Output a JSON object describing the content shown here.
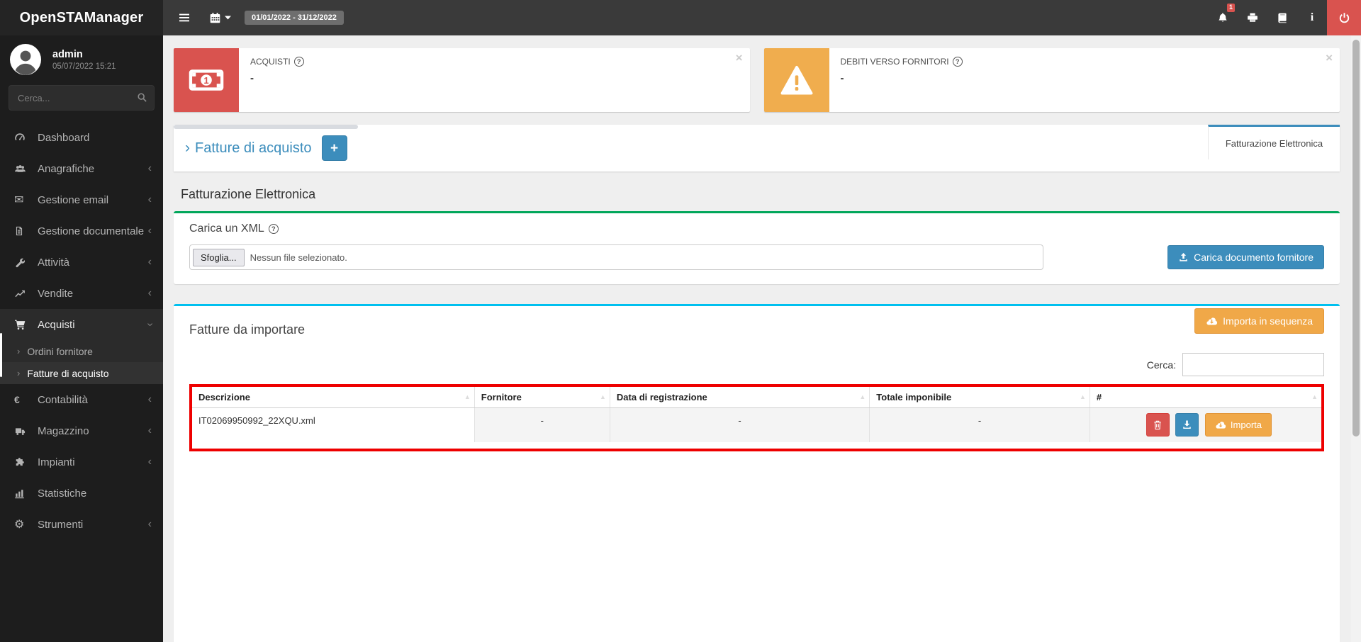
{
  "app": {
    "title": "OpenSTAManager"
  },
  "navbar": {
    "date_range": "01/01/2022 - 31/12/2022",
    "notification_count": "1"
  },
  "sidebar": {
    "user": {
      "name": "admin",
      "datetime": "05/07/2022 15:21"
    },
    "search_placeholder": "Cerca...",
    "items": [
      {
        "label": "Dashboard"
      },
      {
        "label": "Anagrafiche"
      },
      {
        "label": "Gestione email"
      },
      {
        "label": "Gestione documentale"
      },
      {
        "label": "Attività"
      },
      {
        "label": "Vendite"
      },
      {
        "label": "Acquisti"
      },
      {
        "label": "Contabilità"
      },
      {
        "label": "Magazzino"
      },
      {
        "label": "Impianti"
      },
      {
        "label": "Statistiche"
      },
      {
        "label": "Strumenti"
      }
    ],
    "acquisti_submenu": [
      {
        "label": "Ordini fornitore"
      },
      {
        "label": "Fatture di acquisto"
      }
    ]
  },
  "infoboxes": [
    {
      "label": "ACQUISTI",
      "value": "-"
    },
    {
      "label": "DEBITI VERSO FORNITORI",
      "value": "-"
    }
  ],
  "header": {
    "title": "Fatture di acquisto",
    "add_button": "+",
    "tab": "Fatturazione Elettronica"
  },
  "section": {
    "heading": "Fatturazione Elettronica"
  },
  "upload_panel": {
    "title": "Carica un XML",
    "browse_button": "Sfoglia...",
    "file_status": "Nessun file selezionato.",
    "upload_button": "Carica documento fornitore"
  },
  "import_panel": {
    "title": "Fatture da importare",
    "sequence_button": "Importa in sequenza",
    "search_label": "Cerca:",
    "search_value": "",
    "table": {
      "columns": [
        "Descrizione",
        "Fornitore",
        "Data di registrazione",
        "Totale imponibile",
        "#"
      ],
      "rows": [
        {
          "descrizione": "IT02069950992_22XQU.xml",
          "fornitore": "-",
          "data_registrazione": "-",
          "totale_imponibile": "-",
          "importa_label": "Importa"
        }
      ]
    }
  },
  "colors": {
    "primary": "#3c8dbc",
    "success": "#00a65a",
    "info": "#00c0ef",
    "warning": "#f0ad4e",
    "danger": "#d9534f",
    "table_highlight_border": "#ee0000"
  }
}
